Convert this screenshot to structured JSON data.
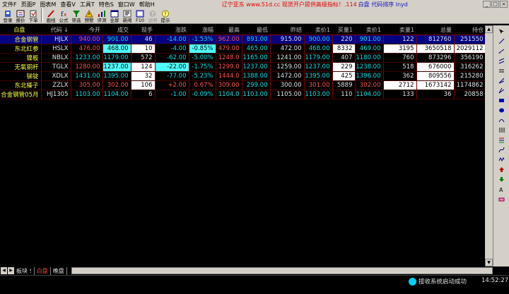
{
  "menu": {
    "items": [
      "文件F",
      "页面P",
      "图表M",
      "查看V",
      "工具T",
      "特色S",
      "窗口W",
      "帮助H"
    ],
    "ad_text": "辽宁亚东 www.51d.cc 现货开户提供高级指标！.114",
    "sort_info": "白盘 代码排序 lnyd"
  },
  "window_buttons": [
    "_",
    "□",
    "×"
  ],
  "toolbar": [
    {
      "label": "登录",
      "icon": "login-icon",
      "disabled": false
    },
    {
      "label": "报价",
      "icon": "quote-icon",
      "disabled": false
    },
    {
      "label": "下单",
      "icon": "order-icon",
      "disabled": false
    },
    {
      "label": "画线",
      "icon": "draw-line-icon",
      "disabled": false
    },
    {
      "label": "公式",
      "icon": "formula-icon",
      "disabled": false
    },
    {
      "label": "筛选",
      "icon": "filter-icon",
      "disabled": false
    },
    {
      "label": "预警",
      "icon": "alert-icon",
      "disabled": false
    },
    {
      "label": "评测",
      "icon": "evaluate-icon",
      "disabled": false
    },
    {
      "label": "全屏",
      "icon": "fullscreen-icon",
      "disabled": false
    },
    {
      "label": "新闻",
      "icon": "news-icon",
      "disabled": false
    },
    {
      "label": "F10",
      "icon": "f10-icon",
      "disabled": false
    },
    {
      "label": "说明",
      "icon": "explain-icon",
      "disabled": true
    },
    {
      "label": "提示",
      "icon": "tip-icon",
      "disabled": false
    }
  ],
  "table": {
    "columns": [
      "白盘",
      "代码 ↓",
      "今开",
      "成交",
      "现手",
      "涨跌",
      "涨幅",
      "最高",
      "最低",
      "昨结",
      "卖价1",
      "买量1",
      "卖价1",
      "卖量1",
      "总量",
      "持仓"
    ],
    "rows": [
      {
        "name": "合金钢管",
        "code": "HJLX",
        "open": "940.00",
        "price": "901.00",
        "vol": "46",
        "chg": "-14.00",
        "pct": "-1.53%",
        "high": "962.00",
        "low": "891.00",
        "settle": "915.00",
        "bid": "900.00",
        "bidvol": "220",
        "ask": "901.00",
        "askvol": "122",
        "total": "812760",
        "oi": "251550"
      },
      {
        "name": "东北红参",
        "code": "HSLX",
        "open": "476.00",
        "price": "468.00",
        "vol": "10",
        "chg": "-4.00",
        "pct": "-0.85%",
        "high": "479.00",
        "low": "465.00",
        "settle": "472.00",
        "bid": "468.00",
        "bidvol": "8332",
        "ask": "469.00",
        "askvol": "3195",
        "total": "3650518",
        "oi": "2029112"
      },
      {
        "name": "镍板",
        "code": "NBLX",
        "open": "1233.00",
        "price": "1179.00",
        "vol": "572",
        "chg": "-62.00",
        "pct": "-5.00%",
        "high": "1248.0",
        "low": "1165.00",
        "settle": "1241.00",
        "bid": "1179.00",
        "bidvol": "407",
        "ask": "1180.00",
        "askvol": "760",
        "total": "873296",
        "oi": "356190"
      },
      {
        "name": "无氧铜杆",
        "code": "TGLX",
        "open": "1280.00",
        "price": "1237.00",
        "vol": "124",
        "chg": "-22.00",
        "pct": "-1.75%",
        "high": "1299.0",
        "low": "1237.00",
        "settle": "1259.00",
        "bid": "1237.00",
        "bidvol": "229",
        "ask": "1238.00",
        "askvol": "518",
        "total": "676000",
        "oi": "316262"
      },
      {
        "name": "锑锭",
        "code": "XDLX",
        "open": "1431.00",
        "price": "1395.00",
        "vol": "32",
        "chg": "-77.00",
        "pct": "-5.23%",
        "high": "1444.0",
        "low": "1388.00",
        "settle": "1472.00",
        "bid": "1395.00",
        "bidvol": "425",
        "ask": "1396.00",
        "askvol": "362",
        "total": "809556",
        "oi": "215280"
      },
      {
        "name": "东北榛子",
        "code": "ZZLX",
        "open": "305.00",
        "price": "302.00",
        "vol": "106",
        "chg": "+2.00",
        "pct": "0.67%",
        "high": "309.00",
        "low": "299.00",
        "settle": "300.00",
        "bid": "301.00",
        "bidvol": "5889",
        "ask": "302.00",
        "askvol": "2712",
        "total": "1673142",
        "oi": "1174862"
      },
      {
        "name": "合金钢管05月",
        "code": "HJ1305",
        "open": "1103.00",
        "price": "1104.00",
        "vol": "6",
        "chg": "-1.00",
        "pct": "-0.09%",
        "high": "1104.0",
        "low": "1103.00",
        "settle": "1105.00",
        "bid": "1103.00",
        "bidvol": "110",
        "ask": "1104.00",
        "askvol": "133",
        "total": "36",
        "oi": "20858"
      }
    ]
  },
  "tabs": [
    {
      "label": "板块 !",
      "active": false
    },
    {
      "label": "白盘",
      "active": true
    },
    {
      "label": "晚盘",
      "active": false
    }
  ],
  "status": {
    "message": "接收系统启动成功",
    "time": "14:52:27"
  },
  "colors": {
    "up": "#ff5050",
    "down": "#00e0e0",
    "highlight_cyan": "#50ffff",
    "name_yellow": "#ffff40",
    "selection": "#000080"
  }
}
